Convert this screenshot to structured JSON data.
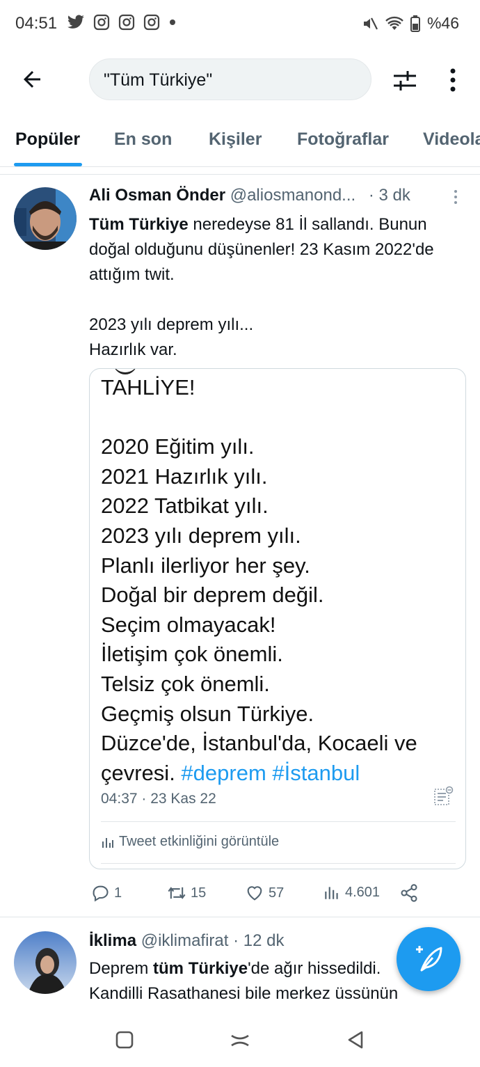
{
  "status_bar": {
    "time": "04:51",
    "left_icons": [
      "twitter-icon",
      "instagram-icon",
      "instagram-icon",
      "instagram-icon",
      "dot-icon"
    ],
    "battery": "%46"
  },
  "search": {
    "query": "\"Tüm Türkiye\""
  },
  "tabs": [
    {
      "label": "Popüler",
      "active": true
    },
    {
      "label": "En son",
      "active": false
    },
    {
      "label": "Kişiler",
      "active": false
    },
    {
      "label": "Fotoğraflar",
      "active": false
    },
    {
      "label": "Videolar",
      "active": false
    }
  ],
  "tweet1": {
    "name": "Ali Osman Önder",
    "handle": "@aliosmanond...",
    "time": "· 3 dk",
    "text_bold": "Tüm Türkiye",
    "text_line1_rest": " neredeyse 81 İl sallandı. Bunun doğal olduğunu düşünenler! 23 Kasım 2022'de attığım twit.",
    "text_line2": "2023 yılı deprem yılı...",
    "text_line3": "Hazırlık var.",
    "quote": {
      "lines": [
        "TAHLİYE!",
        "",
        "2020 Eğitim yılı.",
        "2021 Hazırlık yılı.",
        "2022 Tatbikat yılı.",
        "2023 yılı deprem yılı.",
        "Planlı ilerliyor her şey.",
        "Doğal bir deprem değil.",
        "Seçim olmayacak!",
        "İletişim çok önemli.",
        "Telsiz çok önemli.",
        "Geçmiş olsun Türkiye.",
        "Düzce'de, İstanbul'da, Kocaeli ve"
      ],
      "last_line_prefix": "çevresi. ",
      "hashtags": "#deprem #İstanbul",
      "meta": "04:37 · 23 Kas 22",
      "activity": "Tweet etkinliğini görüntüle"
    },
    "actions": {
      "replies": "1",
      "retweets": "15",
      "likes": "57",
      "views": "4.601"
    }
  },
  "tweet2": {
    "name": "İklima",
    "handle": "@iklimafirat",
    "time": "· 12 dk",
    "text_prefix": "Deprem ",
    "text_bold": "tüm Türkiye",
    "text_rest": "'de ağır hissedildi.",
    "text_line2": "Kandilli Rasathanesi bile merkez üssünün"
  },
  "colors": {
    "accent": "#1d9bf0",
    "secondary_text": "#536471",
    "border": "#cfd9de"
  }
}
